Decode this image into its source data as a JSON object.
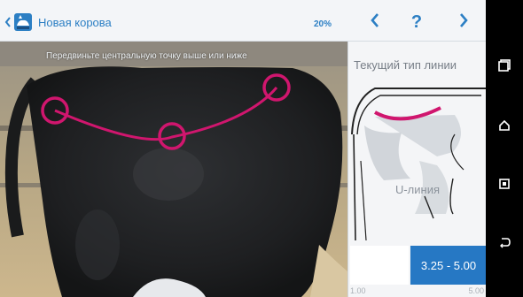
{
  "header": {
    "title": "Новая корова",
    "progress": "20%",
    "help_label": "?"
  },
  "photo": {
    "instruction": "Передвиньте центральную точку выше или ниже"
  },
  "panel": {
    "title": "Текущий тип линии",
    "line_type": "U-линия",
    "range_label": "3.25 - 5.00",
    "scale_min": "1.00",
    "scale_max": "5.00"
  },
  "colors": {
    "accent": "#2c7fc4",
    "line_magenta": "#d0166e",
    "range_blue": "#2678c4"
  },
  "icons": {
    "back": "chevron-left-icon",
    "logo": "cow-app-logo-icon",
    "prev": "chevron-left-icon",
    "next": "chevron-right-icon",
    "recents": "recent-apps-icon",
    "home": "home-icon",
    "screenshot": "screenshot-icon",
    "back_sys": "system-back-icon"
  }
}
